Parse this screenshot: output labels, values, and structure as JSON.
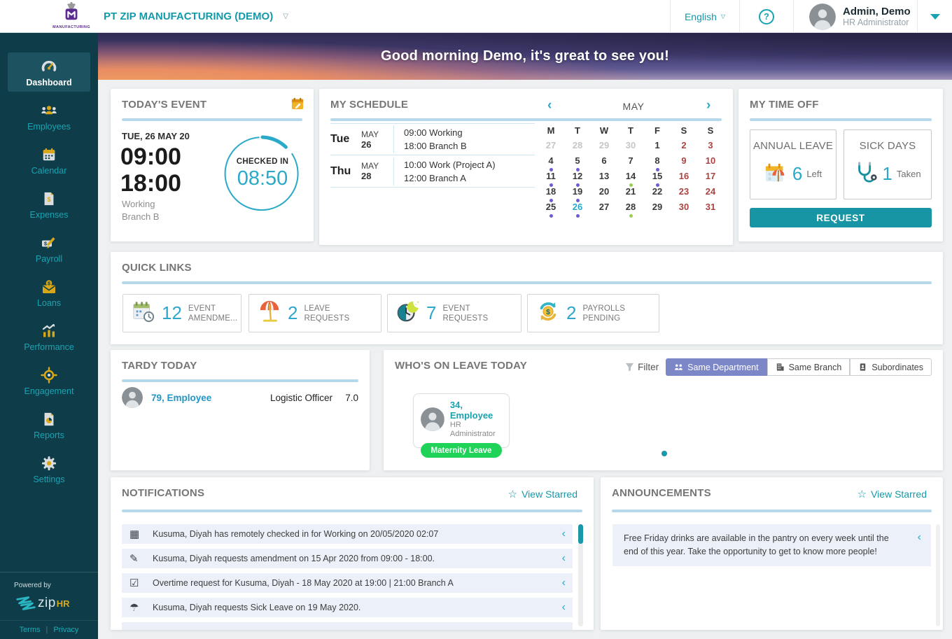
{
  "topbar": {
    "logo_caption": "MANUFACTURING",
    "company_name": "PT ZIP MANUFACTURING (DEMO)",
    "language_label": "English",
    "help_glyph": "?",
    "user_name": "Admin, Demo",
    "user_role": "HR Administrator"
  },
  "sidebar": {
    "items": [
      {
        "label": "Dashboard"
      },
      {
        "label": "Employees"
      },
      {
        "label": "Calendar"
      },
      {
        "label": "Expenses"
      },
      {
        "label": "Payroll"
      },
      {
        "label": "Loans"
      },
      {
        "label": "Performance"
      },
      {
        "label": "Engagement"
      },
      {
        "label": "Reports"
      },
      {
        "label": "Settings"
      }
    ],
    "powered_by": "Powered by",
    "brand_zip": "zip",
    "brand_hr": "HR",
    "terms_label": "Terms",
    "divider": "|",
    "privacy_label": "Privacy"
  },
  "banner": {
    "greeting": "Good morning Demo, it's great to see you!"
  },
  "todays_event": {
    "title": "TODAY'S EVENT",
    "date": "TUE, 26 MAY 20",
    "start_time": "09:00",
    "end_time": "18:00",
    "event_name": "Working",
    "event_branch": "Branch B",
    "checkin_label": "CHECKED IN",
    "checkin_time": "08:50"
  },
  "my_schedule": {
    "title": "MY SCHEDULE",
    "month": "MAY",
    "rows": [
      {
        "day": "Tue",
        "month": "MAY",
        "date": "26",
        "line1": "09:00 Working",
        "line2": "18:00 Branch B"
      },
      {
        "day": "Thu",
        "month": "MAY",
        "date": "28",
        "line1": "10:00 Work (Project A)",
        "line2": "12:00 Branch A"
      }
    ],
    "day_headers": [
      {
        "h": "M"
      },
      {
        "h": "T"
      },
      {
        "h": "W"
      },
      {
        "h": "T"
      },
      {
        "h": "F"
      },
      {
        "h": "S"
      },
      {
        "h": "S"
      }
    ],
    "cells": [
      {
        "d": "27",
        "cls": "muted"
      },
      {
        "d": "28",
        "cls": "muted"
      },
      {
        "d": "29",
        "cls": "muted"
      },
      {
        "d": "30",
        "cls": "muted"
      },
      {
        "d": "1"
      },
      {
        "d": "2",
        "cls": "weekend"
      },
      {
        "d": "3",
        "cls": "weekend"
      },
      {
        "d": "4",
        "dot": "dot-purple"
      },
      {
        "d": "5",
        "dot": "dot-purple"
      },
      {
        "d": "6"
      },
      {
        "d": "7"
      },
      {
        "d": "8",
        "dot": "dot-purple"
      },
      {
        "d": "9",
        "cls": "weekend"
      },
      {
        "d": "10",
        "cls": "weekend"
      },
      {
        "d": "11",
        "dot": "dot-purple"
      },
      {
        "d": "12",
        "dot": "dot-purple"
      },
      {
        "d": "13"
      },
      {
        "d": "14",
        "dot": "dot-green"
      },
      {
        "d": "15",
        "dot": "dot-purple"
      },
      {
        "d": "16",
        "cls": "weekend"
      },
      {
        "d": "17",
        "cls": "weekend"
      },
      {
        "d": "18",
        "dot": "dot-purple"
      },
      {
        "d": "19",
        "dot": "dot-purple"
      },
      {
        "d": "20"
      },
      {
        "d": "21"
      },
      {
        "d": "22"
      },
      {
        "d": "23",
        "cls": "weekend"
      },
      {
        "d": "24",
        "cls": "weekend"
      },
      {
        "d": "25",
        "dot": "dot-purple"
      },
      {
        "d": "26",
        "cls": "selected",
        "dot": "dot-purple"
      },
      {
        "d": "27"
      },
      {
        "d": "28",
        "dot": "dot-green"
      },
      {
        "d": "29"
      },
      {
        "d": "30",
        "cls": "weekend"
      },
      {
        "d": "31",
        "cls": "weekend"
      }
    ]
  },
  "my_time_off": {
    "title": "MY TIME OFF",
    "annual": {
      "label": "ANNUAL LEAVE",
      "value": "6",
      "unit": "Left"
    },
    "sick": {
      "label": "SICK DAYS",
      "value": "1",
      "unit": "Taken"
    },
    "request_label": "REQUEST"
  },
  "quick_links": {
    "title": "QUICK LINKS",
    "items": [
      {
        "icon": "calendar-clock-icon",
        "value": "12",
        "label": "EVENT AMENDME..."
      },
      {
        "icon": "beach-umbrella-icon",
        "value": "2",
        "label": "LEAVE REQUESTS"
      },
      {
        "icon": "clock-moon-icon",
        "value": "7",
        "label": "EVENT REQUESTS"
      },
      {
        "icon": "payroll-sync-icon",
        "value": "2",
        "label": "PAYROLLS PENDING"
      }
    ]
  },
  "tardy_today": {
    "title": "TARDY TODAY",
    "rows": [
      {
        "name": "79, Employee",
        "position": "Logistic Officer",
        "value": "7.0"
      }
    ]
  },
  "whos_on_leave": {
    "title": "WHO'S ON LEAVE TODAY",
    "filter_label": "Filter",
    "buttons": [
      {
        "label": "Same Department",
        "selected": true
      },
      {
        "label": "Same Branch",
        "selected": false
      },
      {
        "label": "Subordinates",
        "selected": false
      }
    ],
    "cards": [
      {
        "name": "34, Employee",
        "role": "HR Administrator",
        "badge": "Maternity Leave"
      }
    ]
  },
  "notifications": {
    "title": "NOTIFICATIONS",
    "view_starred": "View Starred",
    "items": [
      {
        "icon": "ic-cal-grid",
        "text": "Kusuma, Diyah has remotely checked in for Working on 20/05/2020 02:07"
      },
      {
        "icon": "ic-cal-edit",
        "text": "Kusuma, Diyah requests amendment on 15 Apr 2020 from 09:00 - 18:00."
      },
      {
        "icon": "ic-cal-check",
        "text": "Overtime request for Kusuma, Diyah - 18 May 2020 at 19:00 | 21:00 Branch A"
      },
      {
        "icon": "ic-umbrella",
        "text": "Kusuma, Diyah requests Sick Leave on 19 May 2020."
      }
    ]
  },
  "announcements": {
    "title": "ANNOUNCEMENTS",
    "view_starred": "View Starred",
    "items": [
      {
        "text": "Free Friday drinks are available in the pantry on every week until the end of this year. Take the opportunity to get to know more people!"
      }
    ]
  }
}
